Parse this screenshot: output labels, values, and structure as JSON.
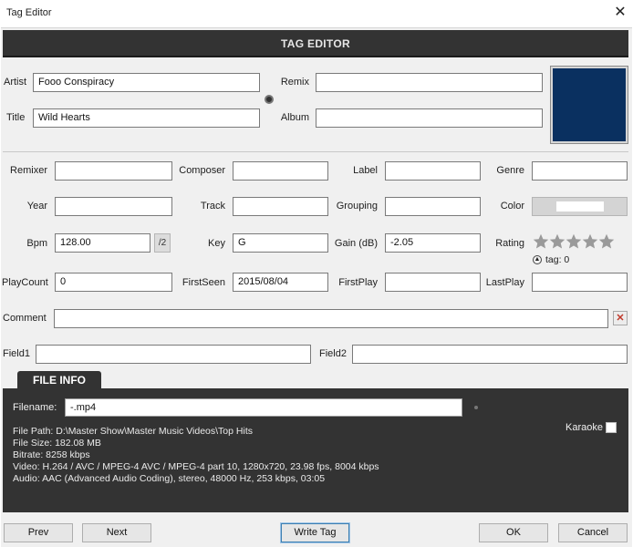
{
  "window": {
    "title": "Tag Editor",
    "close_glyph": "✕"
  },
  "header": {
    "title": "TAG EDITOR"
  },
  "main": {
    "artist_label": "Artist",
    "artist_value": "Fooo Conspiracy",
    "title_label": "Title",
    "title_value": "Wild Hearts",
    "remix_label": "Remix",
    "remix_value": "",
    "album_label": "Album",
    "album_value": "",
    "cover_color": "#0a3060"
  },
  "fields": {
    "remixer_label": "Remixer",
    "remixer_value": "",
    "composer_label": "Composer",
    "composer_value": "",
    "label_label": "Label",
    "label_value": "",
    "genre_label": "Genre",
    "genre_value": "",
    "year_label": "Year",
    "year_value": "",
    "track_label": "Track",
    "track_value": "",
    "grouping_label": "Grouping",
    "grouping_value": "",
    "color_label": "Color",
    "color_value": "#ffffff",
    "bpm_label": "Bpm",
    "bpm_value": "128.00",
    "half_label": "/2",
    "key_label": "Key",
    "key_value": "G",
    "gain_label": "Gain (dB)",
    "gain_value": "-2.05",
    "rating_label": "Rating",
    "rating_stars": 0,
    "rating_max": 5,
    "rating_tag": "tag: 0",
    "playcount_label": "PlayCount",
    "playcount_value": "0",
    "firstseen_label": "FirstSeen",
    "firstseen_value": "2015/08/04",
    "firstplay_label": "FirstPlay",
    "firstplay_value": "",
    "lastplay_label": "LastPlay",
    "lastplay_value": "",
    "comment_label": "Comment",
    "comment_value": "",
    "comment_clear_glyph": "✕",
    "field1_label": "Field1",
    "field1_value": "",
    "field2_label": "Field2",
    "field2_value": ""
  },
  "file_info": {
    "tab_label": "FILE INFO",
    "filename_label": "Filename:",
    "filename_value": "-.mp4",
    "karaoke_label": "Karaoke",
    "karaoke_checked": false,
    "path_line": "File Path: D:\\Master Show\\Master Music Videos\\Top Hits",
    "size_line": "File Size: 182.08 MB",
    "bitrate_line": "Bitrate: 8258 kbps",
    "video_line": "Video: H.264 / AVC / MPEG-4 AVC / MPEG-4 part 10, 1280x720, 23.98 fps, 8004 kbps",
    "audio_line": "Audio: AAC (Advanced Audio Coding), stereo, 48000 Hz, 253 kbps, 03:05"
  },
  "buttons": {
    "prev": "Prev",
    "next": "Next",
    "write_tag": "Write Tag",
    "ok": "OK",
    "cancel": "Cancel"
  },
  "icons": {
    "close": "close-icon",
    "clear": "clear-icon",
    "star": "star-icon"
  }
}
